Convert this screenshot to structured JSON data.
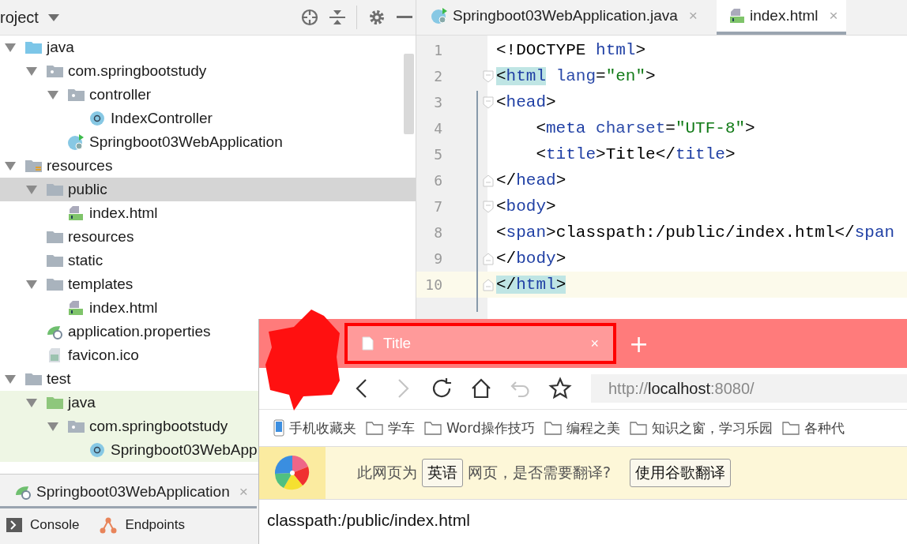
{
  "project_panel": {
    "title": "roject",
    "tree": [
      {
        "label": "java",
        "kind": "source-folder",
        "expanded": true,
        "selected": false,
        "tinted": false,
        "children": [
          {
            "label": "com.springbootstudy",
            "kind": "package",
            "expanded": true,
            "selected": false,
            "tinted": false,
            "children": [
              {
                "label": "controller",
                "kind": "package",
                "expanded": true,
                "selected": false,
                "tinted": false,
                "children": [
                  {
                    "label": "IndexController",
                    "kind": "class",
                    "selected": false,
                    "tinted": false
                  }
                ]
              },
              {
                "label": "Springboot03WebApplication",
                "kind": "spring-class",
                "selected": false,
                "tinted": false
              }
            ]
          }
        ]
      },
      {
        "label": "resources",
        "kind": "resource-folder",
        "expanded": true,
        "selected": false,
        "tinted": false,
        "children": [
          {
            "label": "public",
            "kind": "folder",
            "expanded": true,
            "selected": true,
            "tinted": false,
            "children": [
              {
                "label": "index.html",
                "kind": "html",
                "selected": false,
                "tinted": false
              }
            ]
          },
          {
            "label": "resources",
            "kind": "folder",
            "selected": false,
            "tinted": false
          },
          {
            "label": "static",
            "kind": "folder",
            "selected": false,
            "tinted": false
          },
          {
            "label": "templates",
            "kind": "folder",
            "expanded": true,
            "selected": false,
            "tinted": false,
            "children": [
              {
                "label": "index.html",
                "kind": "html",
                "selected": false,
                "tinted": false
              }
            ]
          },
          {
            "label": "application.properties",
            "kind": "spring-props",
            "selected": false,
            "tinted": false
          },
          {
            "label": "favicon.ico",
            "kind": "image",
            "selected": false,
            "tinted": false
          }
        ]
      },
      {
        "label": "test",
        "kind": "folder",
        "expanded": true,
        "selected": false,
        "tinted": false,
        "children": [
          {
            "label": "java",
            "kind": "test-folder",
            "expanded": true,
            "selected": false,
            "tinted": true,
            "children": [
              {
                "label": "com.springbootstudy",
                "kind": "package",
                "expanded": true,
                "selected": false,
                "tinted": true,
                "children": [
                  {
                    "label": "Springboot03WebApp",
                    "kind": "class",
                    "selected": false,
                    "tinted": true
                  }
                ]
              }
            ]
          }
        ]
      }
    ]
  },
  "run_panel": {
    "tab": {
      "label": "Springboot03WebApplication",
      "close": "×"
    },
    "tools": [
      {
        "label": "Console",
        "kind": "console"
      },
      {
        "label": "Endpoints",
        "kind": "endpoints"
      }
    ]
  },
  "editor": {
    "tabs": [
      {
        "label": "Springboot03WebApplication.java",
        "kind": "spring-class",
        "close": "×",
        "selected": false
      },
      {
        "label": "index.html",
        "kind": "html",
        "close": "×",
        "selected": true
      }
    ],
    "lines": [
      {
        "number": "1",
        "current": false,
        "kind": "plain",
        "tokens": [
          {
            "kind": "punct",
            "text": "<!DOCTYPE "
          },
          {
            "kind": "tag",
            "text": "html"
          },
          {
            "kind": "punct",
            "text": ">"
          }
        ]
      },
      {
        "number": "2",
        "current": false,
        "kind": "fold-start",
        "tokens": [
          {
            "kind": "punct",
            "text": "<",
            "matched": true
          },
          {
            "kind": "tag",
            "text": "html",
            "matched": true
          },
          {
            "kind": "attr",
            "text": " lang"
          },
          {
            "kind": "punct",
            "text": "="
          },
          {
            "kind": "string",
            "text": "\"en\""
          },
          {
            "kind": "punct",
            "text": ">"
          }
        ]
      },
      {
        "number": "3",
        "current": false,
        "kind": "fold-start",
        "tokens": [
          {
            "kind": "punct",
            "text": "<"
          },
          {
            "kind": "tag",
            "text": "head"
          },
          {
            "kind": "punct",
            "text": ">"
          }
        ]
      },
      {
        "number": "4",
        "current": false,
        "kind": "plain",
        "tokens": [
          {
            "kind": "punct",
            "text": "    <"
          },
          {
            "kind": "tag",
            "text": "meta"
          },
          {
            "kind": "attr",
            "text": " charset"
          },
          {
            "kind": "punct",
            "text": "="
          },
          {
            "kind": "string",
            "text": "\"UTF-8\""
          },
          {
            "kind": "punct",
            "text": ">"
          }
        ]
      },
      {
        "number": "5",
        "current": false,
        "kind": "plain",
        "tokens": [
          {
            "kind": "punct",
            "text": "    <"
          },
          {
            "kind": "tag",
            "text": "title"
          },
          {
            "kind": "punct",
            "text": ">"
          },
          {
            "kind": "text",
            "text": "Title"
          },
          {
            "kind": "punct",
            "text": "</"
          },
          {
            "kind": "tag",
            "text": "title"
          },
          {
            "kind": "punct",
            "text": ">"
          }
        ]
      },
      {
        "number": "6",
        "current": false,
        "kind": "fold-end",
        "tokens": [
          {
            "kind": "punct",
            "text": "</"
          },
          {
            "kind": "tag",
            "text": "head"
          },
          {
            "kind": "punct",
            "text": ">"
          }
        ]
      },
      {
        "number": "7",
        "current": false,
        "kind": "fold-start",
        "tokens": [
          {
            "kind": "punct",
            "text": "<"
          },
          {
            "kind": "tag",
            "text": "body"
          },
          {
            "kind": "punct",
            "text": ">"
          }
        ]
      },
      {
        "number": "8",
        "current": false,
        "kind": "plain",
        "tokens": [
          {
            "kind": "punct",
            "text": "<"
          },
          {
            "kind": "tag",
            "text": "span"
          },
          {
            "kind": "punct",
            "text": ">"
          },
          {
            "kind": "text",
            "text": "classpath:/public/index.html"
          },
          {
            "kind": "punct",
            "text": "</"
          },
          {
            "kind": "tag",
            "text": "span"
          }
        ]
      },
      {
        "number": "9",
        "current": false,
        "kind": "fold-end",
        "tokens": [
          {
            "kind": "punct",
            "text": "</"
          },
          {
            "kind": "tag",
            "text": "body"
          },
          {
            "kind": "punct",
            "text": ">"
          }
        ]
      },
      {
        "number": "10",
        "current": true,
        "kind": "fold-end",
        "tokens": [
          {
            "kind": "punct",
            "text": "</",
            "matched": true
          },
          {
            "kind": "tag",
            "text": "html",
            "matched": true
          },
          {
            "kind": "punct",
            "text": ">",
            "matched": true
          }
        ]
      }
    ]
  },
  "browser": {
    "tab": {
      "title": "Title",
      "close": "×",
      "selected": true
    },
    "new_tab": "+",
    "nav": [
      {
        "kind": "back",
        "disabled": false
      },
      {
        "kind": "forward",
        "disabled": true
      },
      {
        "kind": "reload",
        "disabled": false
      },
      {
        "kind": "home",
        "disabled": false
      },
      {
        "kind": "undo",
        "disabled": true
      },
      {
        "kind": "star",
        "disabled": false
      }
    ],
    "address": [
      {
        "text": "http://",
        "emphasis": false
      },
      {
        "text": "localhost",
        "emphasis": true
      },
      {
        "text": ":8080/",
        "emphasis": false
      }
    ],
    "bookmarks": [
      {
        "label": "手机收藏夹",
        "kind": "phone"
      },
      {
        "label": "学车",
        "kind": "folder"
      },
      {
        "label": "Word操作技巧",
        "kind": "folder"
      },
      {
        "label": "编程之美",
        "kind": "folder"
      },
      {
        "label": "知识之窗，学习乐园",
        "kind": "folder"
      },
      {
        "label": "各种代",
        "kind": "folder"
      }
    ],
    "translate": [
      {
        "kind": "text",
        "text": "此网页为"
      },
      {
        "kind": "button",
        "text": "英语"
      },
      {
        "kind": "text",
        "text": "网页，是否需要翻译?"
      },
      {
        "kind": "button",
        "text": "使用谷歌翻译"
      }
    ],
    "content": "classpath:/public/index.html"
  }
}
